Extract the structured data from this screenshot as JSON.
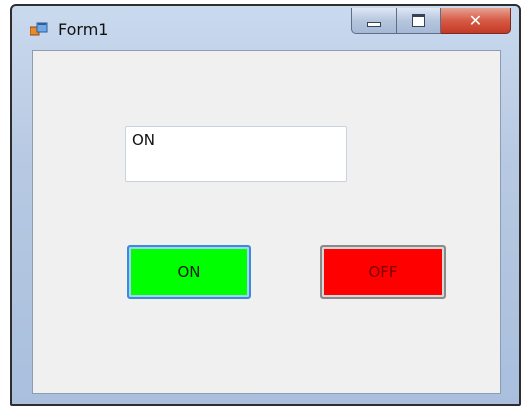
{
  "window": {
    "title": "Form1",
    "close_glyph": "✕"
  },
  "textbox": {
    "value": "ON"
  },
  "buttons": {
    "on": {
      "label": "ON",
      "color": "#00ff00"
    },
    "off": {
      "label": "OFF",
      "color": "#ff0000"
    }
  },
  "icons": {
    "app": "form-app-icon",
    "minimize": "minimize-icon",
    "maximize": "maximize-icon",
    "close": "close-icon"
  }
}
